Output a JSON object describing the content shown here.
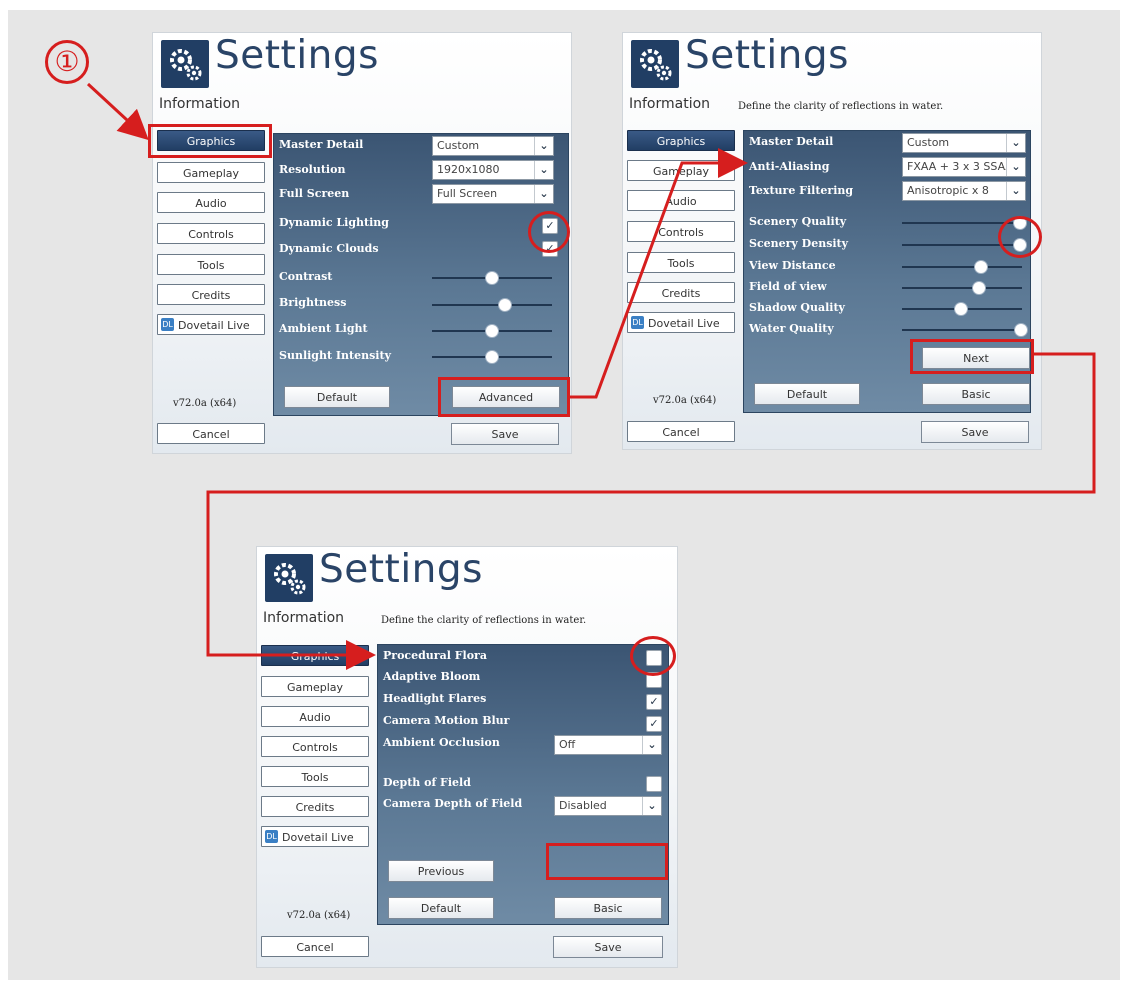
{
  "step_number": "①",
  "common": {
    "title": "Settings",
    "information_label": "Information",
    "version": "v72.0a (x64)",
    "nav": [
      "Graphics",
      "Gameplay",
      "Audio",
      "Controls",
      "Tools",
      "Credits",
      "Dovetail Live"
    ],
    "cancel": "Cancel",
    "save": "Save",
    "default": "Default"
  },
  "panel1": {
    "settings": [
      {
        "label": "Master Detail",
        "type": "select",
        "value": "Custom"
      },
      {
        "label": "Resolution",
        "type": "select",
        "value": "1920x1080"
      },
      {
        "label": "Full Screen",
        "type": "select",
        "value": "Full Screen"
      },
      {
        "label": "Dynamic Lighting",
        "type": "checkbox",
        "checked": true
      },
      {
        "label": "Dynamic Clouds",
        "type": "checkbox",
        "checked": true
      },
      {
        "label": "Contrast",
        "type": "slider",
        "level": 0.5
      },
      {
        "label": "Brightness",
        "type": "slider",
        "level": 0.6
      },
      {
        "label": "Ambient Light",
        "type": "slider",
        "level": 0.5
      },
      {
        "label": "Sunlight Intensity",
        "type": "slider",
        "level": 0.5
      }
    ],
    "advanced": "Advanced"
  },
  "panel2": {
    "description": "Define the clarity of reflections in water.",
    "settings": [
      {
        "label": "Master Detail",
        "type": "select",
        "value": "Custom"
      },
      {
        "label": "Anti-Aliasing",
        "type": "select",
        "value": "FXAA + 3 x 3 SSAA"
      },
      {
        "label": "Texture Filtering",
        "type": "select",
        "value": "Anisotropic x 8"
      },
      {
        "label": "Scenery Quality",
        "type": "slider",
        "level": 1.0
      },
      {
        "label": "Scenery Density",
        "type": "slider",
        "level": 1.0
      },
      {
        "label": "View Distance",
        "type": "slider",
        "level": 0.65
      },
      {
        "label": "Field of view",
        "type": "slider",
        "level": 0.62
      },
      {
        "label": "Shadow Quality",
        "type": "slider",
        "level": 0.45
      },
      {
        "label": "Water Quality",
        "type": "slider",
        "level": 1.0
      }
    ],
    "next": "Next",
    "basic": "Basic"
  },
  "panel3": {
    "description": "Define the clarity of reflections in water.",
    "settings": [
      {
        "label": "Procedural Flora",
        "type": "checkbox",
        "checked": false
      },
      {
        "label": "Adaptive Bloom",
        "type": "checkbox",
        "checked": false
      },
      {
        "label": "Headlight Flares",
        "type": "checkbox",
        "checked": true
      },
      {
        "label": "Camera Motion Blur",
        "type": "checkbox",
        "checked": true
      },
      {
        "label": "Ambient Occlusion",
        "type": "select",
        "value": "Off"
      },
      {
        "label": "Depth of Field",
        "type": "checkbox",
        "checked": false
      },
      {
        "label": "Camera Depth of Field",
        "type": "select",
        "value": "Disabled"
      }
    ],
    "previous": "Previous",
    "basic": "Basic"
  },
  "colors": {
    "highlight_red": "#d61e1e",
    "navy": "#213e64",
    "content_panel": "#4e6b88"
  },
  "icons": [
    "gears-icon",
    "chevron-down-icon",
    "checkmark-icon",
    "dovetail-live-icon"
  ]
}
